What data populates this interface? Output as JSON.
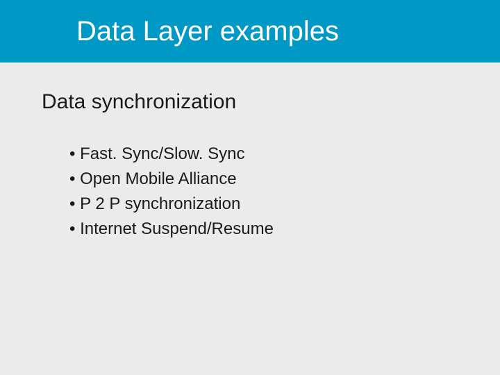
{
  "header": {
    "title": "Data Layer examples"
  },
  "section": {
    "subtitle": "Data synchronization"
  },
  "bullets": [
    "Fast. Sync/Slow. Sync",
    "Open Mobile Alliance",
    "P 2 P synchronization",
    "Internet Suspend/Resume"
  ]
}
